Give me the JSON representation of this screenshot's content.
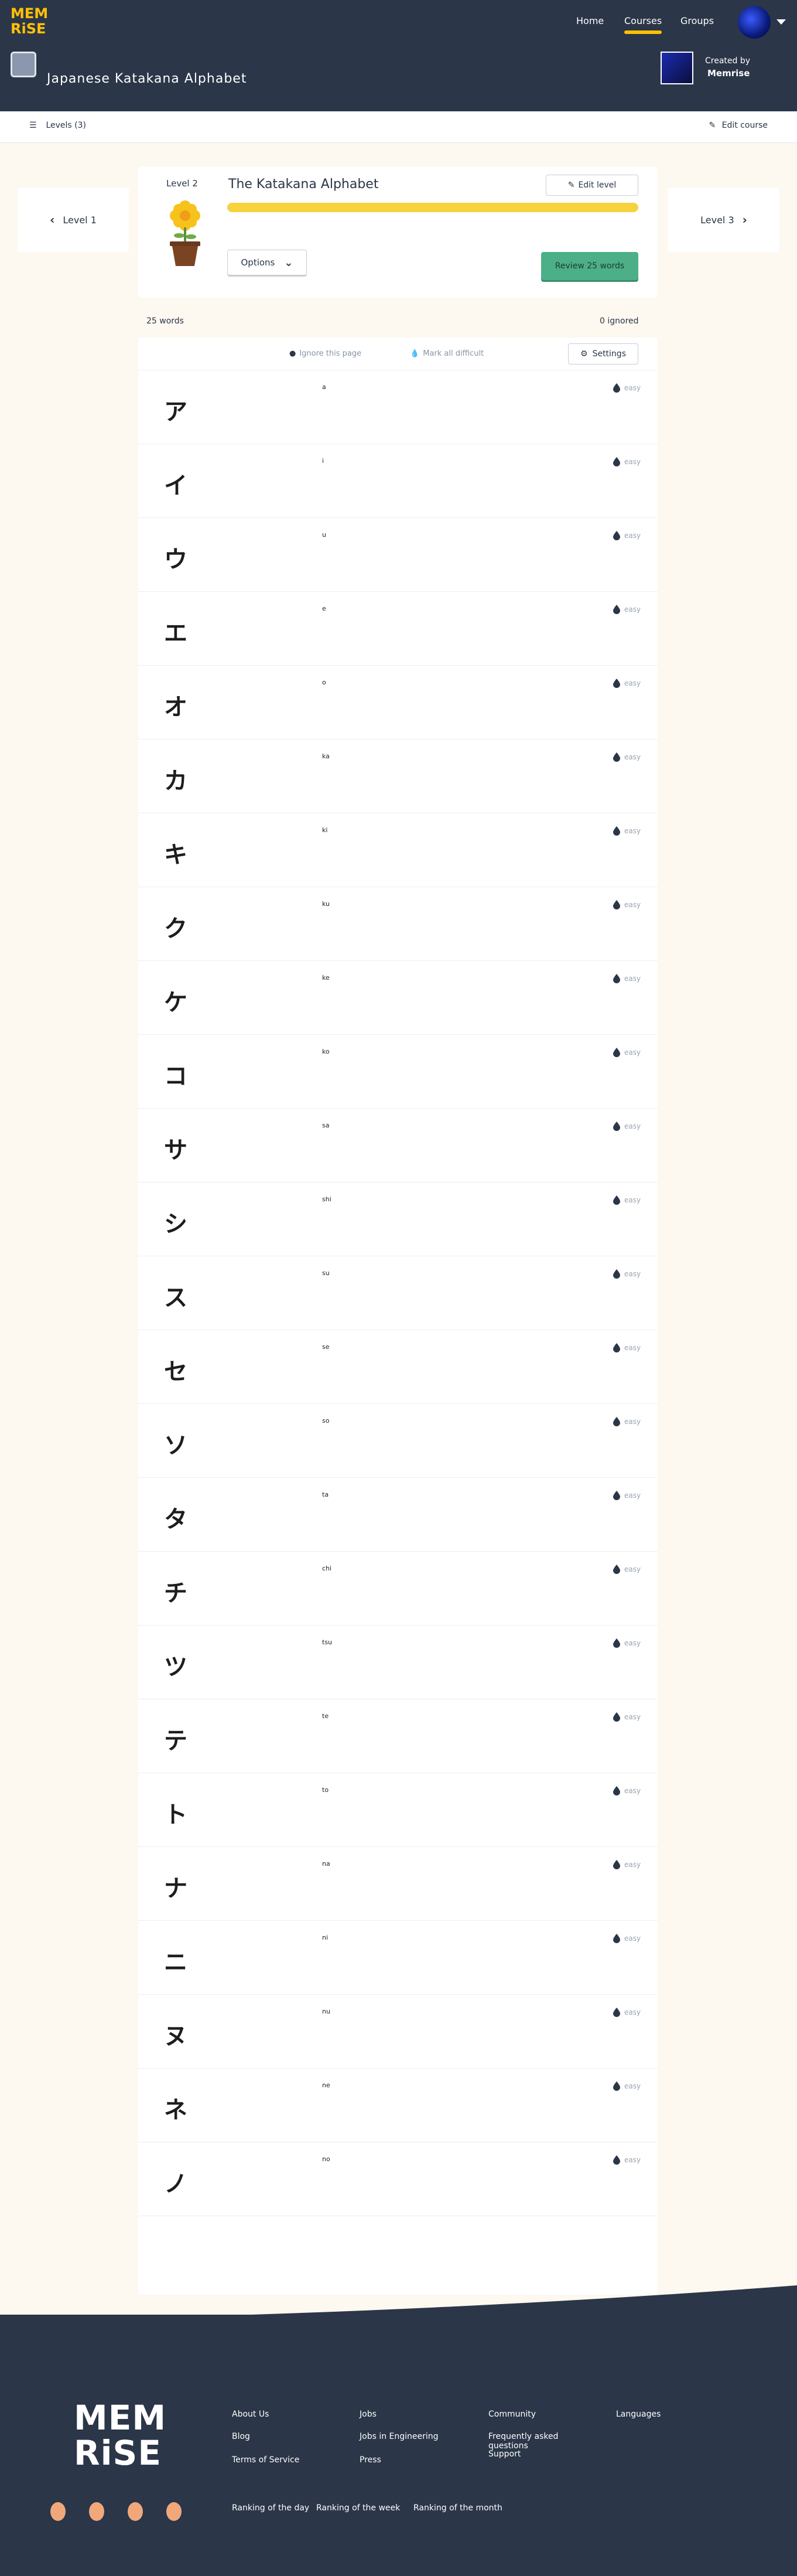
{
  "brand": {
    "logo_line1": "MEM",
    "logo_line2": "RiSE",
    "accent": "#ffc107"
  },
  "nav": {
    "home": "Home",
    "courses": "Courses",
    "groups": "Groups"
  },
  "course": {
    "title": "Japanese Katakana Alphabet",
    "created_by_label": "Created by",
    "creator": "Memrise"
  },
  "subbar": {
    "levels_label": "Levels (3)",
    "edit_course_label": "Edit course"
  },
  "prev_level": {
    "label": "Level 1"
  },
  "next_level": {
    "label": "Level 3"
  },
  "level": {
    "number_label": "Level 2",
    "name": "The Katakana Alphabet",
    "edit_label": "Edit level",
    "progress": 1.0,
    "options_label": "Options",
    "review_label": "Review 25 words"
  },
  "counts": {
    "words": "25 words",
    "ignored": "0 ignored"
  },
  "list_header": {
    "ignore_all": "Ignore this page",
    "difficult_all": "Mark all difficult",
    "settings_label": "Settings"
  },
  "words": [
    {
      "glyph": "ア",
      "meaning": "a",
      "diff": "easy"
    },
    {
      "glyph": "イ",
      "meaning": "i",
      "diff": "easy"
    },
    {
      "glyph": "ウ",
      "meaning": "u",
      "diff": "easy"
    },
    {
      "glyph": "エ",
      "meaning": "e",
      "diff": "easy"
    },
    {
      "glyph": "オ",
      "meaning": "o",
      "diff": "easy"
    },
    {
      "glyph": "カ",
      "meaning": "ka",
      "diff": "easy"
    },
    {
      "glyph": "キ",
      "meaning": "ki",
      "diff": "easy"
    },
    {
      "glyph": "ク",
      "meaning": "ku",
      "diff": "easy"
    },
    {
      "glyph": "ケ",
      "meaning": "ke",
      "diff": "easy"
    },
    {
      "glyph": "コ",
      "meaning": "ko",
      "diff": "easy"
    },
    {
      "glyph": "サ",
      "meaning": "sa",
      "diff": "easy"
    },
    {
      "glyph": "シ",
      "meaning": "shi",
      "diff": "easy"
    },
    {
      "glyph": "ス",
      "meaning": "su",
      "diff": "easy"
    },
    {
      "glyph": "セ",
      "meaning": "se",
      "diff": "easy"
    },
    {
      "glyph": "ソ",
      "meaning": "so",
      "diff": "easy"
    },
    {
      "glyph": "タ",
      "meaning": "ta",
      "diff": "easy"
    },
    {
      "glyph": "チ",
      "meaning": "chi",
      "diff": "easy"
    },
    {
      "glyph": "ツ",
      "meaning": "tsu",
      "diff": "easy"
    },
    {
      "glyph": "テ",
      "meaning": "te",
      "diff": "easy"
    },
    {
      "glyph": "ト",
      "meaning": "to",
      "diff": "easy"
    },
    {
      "glyph": "ナ",
      "meaning": "na",
      "diff": "easy"
    },
    {
      "glyph": "ニ",
      "meaning": "ni",
      "diff": "easy"
    },
    {
      "glyph": "ヌ",
      "meaning": "nu",
      "diff": "easy"
    },
    {
      "glyph": "ネ",
      "meaning": "ne",
      "diff": "easy"
    },
    {
      "glyph": "ノ",
      "meaning": "no",
      "diff": "easy"
    }
  ],
  "footer": {
    "logo_line1": "MEM",
    "logo_line2": "RiSE",
    "col1": [
      "About Us",
      "Blog",
      "Terms of Service"
    ],
    "col2": [
      "Jobs",
      "Jobs in Engineering",
      "Press"
    ],
    "col3": [
      "Community",
      "Frequently asked questions",
      "Support"
    ],
    "col4": [
      "Languages"
    ],
    "bottom": [
      "Ranking of the day",
      "Ranking of the week",
      "Ranking of the month"
    ]
  }
}
